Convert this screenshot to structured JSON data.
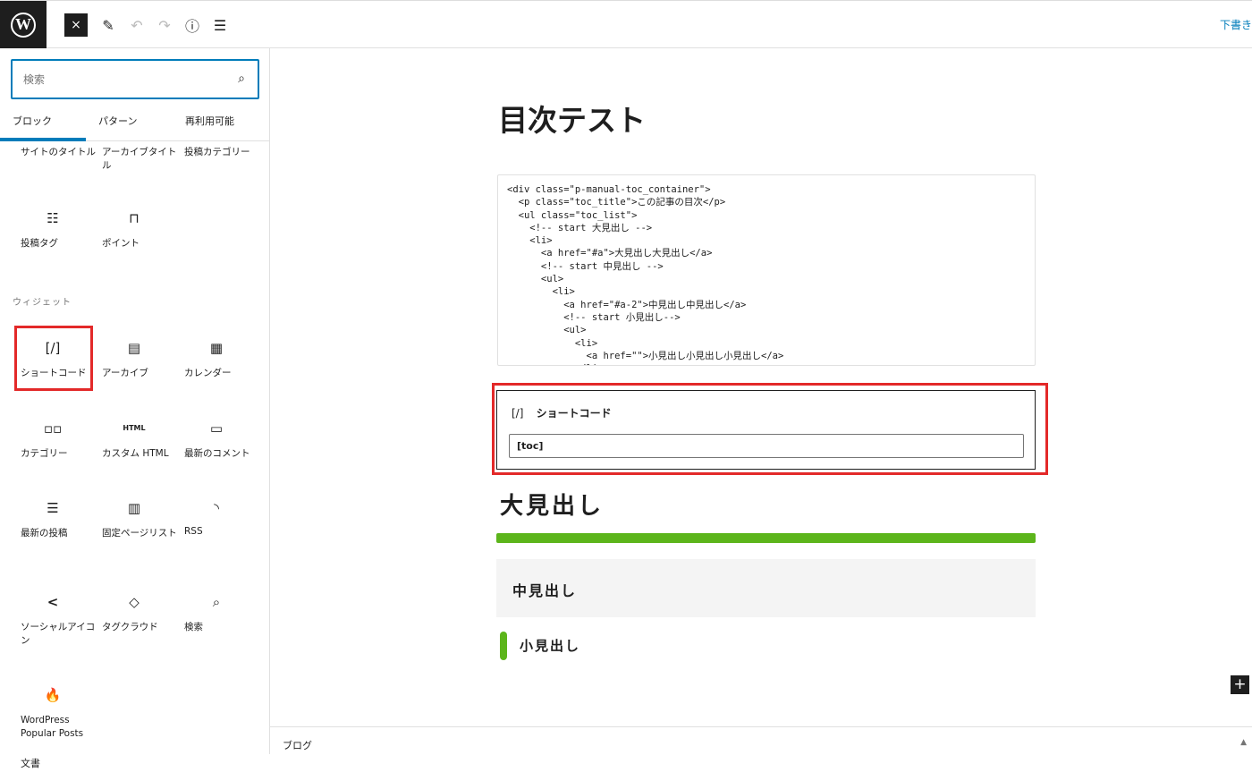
{
  "topbar": {
    "logo_letter": "W",
    "close_icon": "×",
    "edit_icon": "✎",
    "undo_icon": "↶",
    "redo_icon": "↷",
    "info_icon": "ⓘ",
    "list_icon": "☰",
    "right_link": "下書き"
  },
  "sidebar": {
    "search": {
      "placeholder": "検索",
      "icon": "⌕"
    },
    "tabs": [
      {
        "label": "ブロック",
        "active": true
      },
      {
        "label": "パターン",
        "active": false
      },
      {
        "label": "再利用可能",
        "active": false
      }
    ],
    "theme_blocks": [
      {
        "label": "サイトのタイトル",
        "icon": ""
      },
      {
        "label": "アーカイブタイトル",
        "icon": ""
      },
      {
        "label": "投稿カテゴリー",
        "icon": ""
      },
      {
        "label": "投稿タグ",
        "icon": "☷"
      },
      {
        "label": "ポイント",
        "icon": "⊓"
      }
    ],
    "widget_category": "ウィジェット",
    "widgets": [
      {
        "label": "ショートコード",
        "icon": "[/]"
      },
      {
        "label": "アーカイブ",
        "icon": "▤"
      },
      {
        "label": "カレンダー",
        "icon": "▦"
      },
      {
        "label": "カテゴリー",
        "icon": "▫▫"
      },
      {
        "label": "カスタム HTML",
        "icon": "HTML"
      },
      {
        "label": "最新のコメント",
        "icon": "▭"
      },
      {
        "label": "最新の投稿",
        "icon": "☰"
      },
      {
        "label": "固定ページリスト",
        "icon": "▥"
      },
      {
        "label": "RSS",
        "icon": "◝"
      },
      {
        "label": "ソーシャルアイコン",
        "icon": "<"
      },
      {
        "label": "タグクラウド",
        "icon": "◇"
      },
      {
        "label": "検索",
        "icon": "⌕"
      },
      {
        "label": "WordPress Popular Posts",
        "icon": "🔥"
      }
    ]
  },
  "editor": {
    "title": "目次テスト",
    "code": "<div class=\"p-manual-toc_container\">\n  <p class=\"toc_title\">この記事の目次</p>\n  <ul class=\"toc_list\">\n    <!-- start 大見出し -->\n    <li>\n      <a href=\"#a\">大見出し大見出し</a>\n      <!-- start 中見出し -->\n      <ul>\n        <li>\n          <a href=\"#a-2\">中見出し中見出し</a>\n          <!-- start 小見出し-->\n          <ul>\n            <li>\n              <a href=\"\">小見出し小見出し小見出し</a>\n            </li>",
    "shortcode": {
      "icon": "[/]",
      "label": "ショートコード",
      "value": "[toc]"
    },
    "heading_large": "大見出し",
    "heading_mid": "中見出し",
    "heading_small": "小見出し",
    "add_icon": "+"
  },
  "footer": {
    "breadcrumb": "ブログ",
    "toggle_icon": "▲",
    "doc_label": "文書"
  },
  "colors": {
    "accent": "#007cba",
    "highlight": "#e32929",
    "green": "#5cb51b"
  }
}
